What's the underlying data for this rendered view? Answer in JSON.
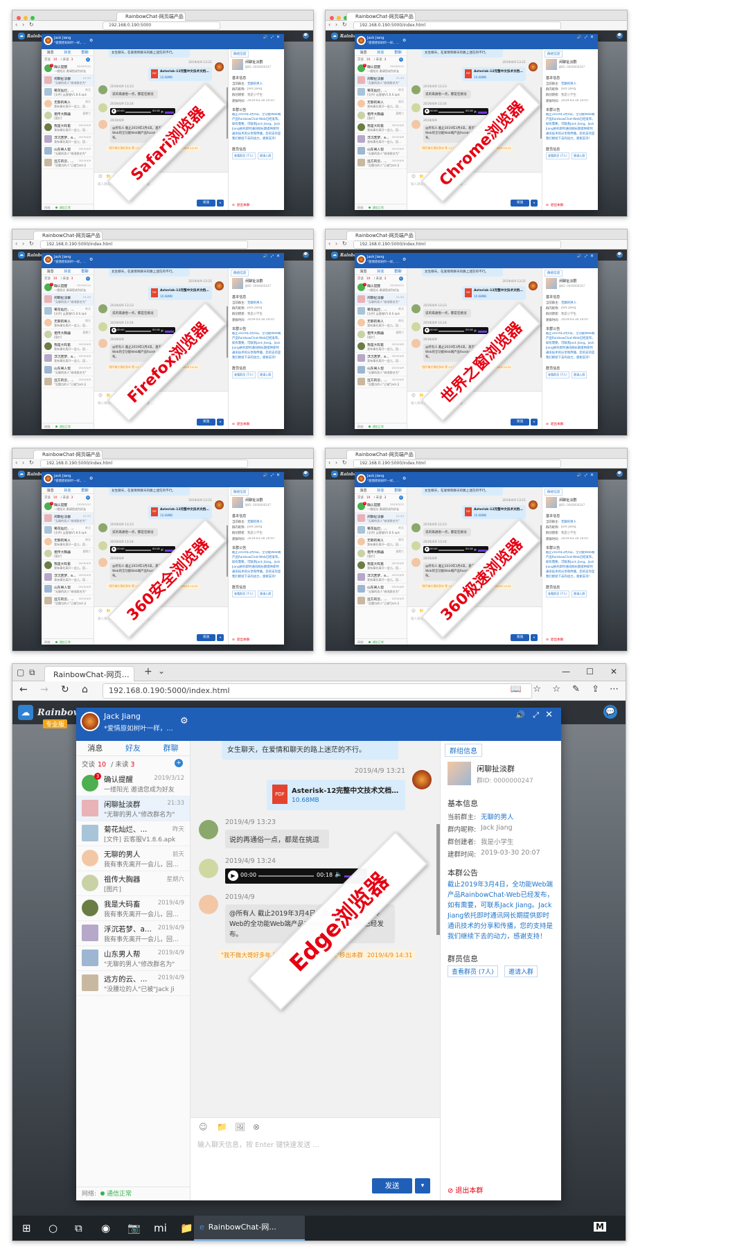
{
  "app": {
    "logo": "RainbowChat·Web",
    "edition": "专业版",
    "url": "192.168.0.190:5000",
    "url_full": "192.168.0.190:5000/index.html",
    "tab_title": "RainbowChat-网页端产品",
    "page_title": "RainbowChat-网页端产",
    "insecure": "不安全"
  },
  "browsers": [
    {
      "label": "Safari浏览器"
    },
    {
      "label": "Chrome浏览器"
    },
    {
      "label": "Firefox浏览器"
    },
    {
      "label": "世界之窗浏览器"
    },
    {
      "label": "360安全浏览器"
    },
    {
      "label": "360极速浏览器"
    },
    {
      "label": "Edge浏览器"
    }
  ],
  "user": {
    "name": "Jack Jiang",
    "signature": "*爱情原如树叶一样，在人忽"
  },
  "nav": {
    "tab_messages": "消息",
    "tab_friends": "好友",
    "tab_groups": "群聊",
    "friends_label": "交谈",
    "friends_count": "10",
    "unread_label": "未读",
    "unread_count": "3"
  },
  "conversations": [
    {
      "name": "确认提醒",
      "time": "2019/3/12",
      "preview": "一缕阳光 邀请您成为好友",
      "badge": "3"
    },
    {
      "name": "闲聊扯淡群",
      "time": "21:33",
      "preview": "\"无聊的男人\"修改群名为\"",
      "group": true
    },
    {
      "name": "菊花灿烂、...",
      "time": "昨天",
      "preview": "[文件] 云客服V1.8.6.apk",
      "group": true
    },
    {
      "name": "无聊的男人",
      "time": "前天",
      "preview": "我有事先离开一会儿，回..."
    },
    {
      "name": "祖传大胸器",
      "time": "星期六",
      "preview": "[图片]"
    },
    {
      "name": "我是大码畜",
      "time": "2019/4/9",
      "preview": "我有事先离开一会儿，回..."
    },
    {
      "name": "浮沉若梦、a...",
      "time": "2019/4/9",
      "preview": "我有事先离开一会儿，回...",
      "group": true
    },
    {
      "name": "山东男人帮",
      "time": "2019/4/9",
      "preview": "\"无聊的男人\"修改群名为\"",
      "group": true
    },
    {
      "name": "远方的云、...",
      "time": "2019/4/9",
      "preview": "\"没腰垃的人\"已被\"Jack Ji",
      "group": true
    }
  ],
  "status": {
    "label": "网络:",
    "value": "通信正常"
  },
  "messages": {
    "top_text": "女生聊天，在爱情和聊天的路上迷茫的不行。",
    "time1": "2019/4/9 13:21",
    "file_name": "Asterisk-12完整中文技术文档...",
    "file_size": "10.68MB",
    "file_icon": "PDF",
    "time2": "2019/4/9 13:23",
    "text2": "说的再通俗一点，都是在挑逗",
    "time3": "2019/4/9 13:24",
    "audio_time": "00:00",
    "audio_end": "00:18",
    "time4": "2019/4/9",
    "text4": "@所有人 截止2019年3月4日，基于MobileIMSDK-Web的全功能Web端产品RainbowChat-Web已经发布。",
    "notice": "\"我不做大哥好多年 等 2人\"已被\"无聊的男人\"移出本群",
    "notice_time": "2019/4/9 14:31"
  },
  "composer": {
    "placeholder": "输入聊天信息，按 Enter 键快速发送 ...",
    "send": "发送"
  },
  "group_info": {
    "tab": "群组信息",
    "name": "闲聊扯淡群",
    "id": "群ID: 0000000247",
    "basic_title": "基本信息",
    "owner_label": "当前群主:",
    "owner": "无聊的男人",
    "nick_label": "群内昵称:",
    "nick": "Jack Jiang",
    "creator_label": "群创建者:",
    "creator": "我是小学生",
    "created_label": "建群时间:",
    "created": "2019-03-30 20:07",
    "notice_title": "本群公告",
    "notice": "截止2019年3月4日，全功能Web端产品RainbowChat-Web已经发布，如有需要，可联系Jack Jiang。Jack Jiang依托即时通讯网长期提供即时通讯技术的分享和传播，您的支持是我们继续下去的动力，感谢支持！",
    "members_title": "群员信息",
    "view_members": "查看群员 (7人)",
    "invite": "邀请入群",
    "quit": "退出本群"
  },
  "taskbar": {
    "active_app": "RainbowChat-网..."
  },
  "colors": {
    "primary": "#1f5fb8",
    "link": "#1e73c8",
    "danger": "#e60012",
    "online": "#37b24d",
    "background_dark": "#2f3338"
  }
}
